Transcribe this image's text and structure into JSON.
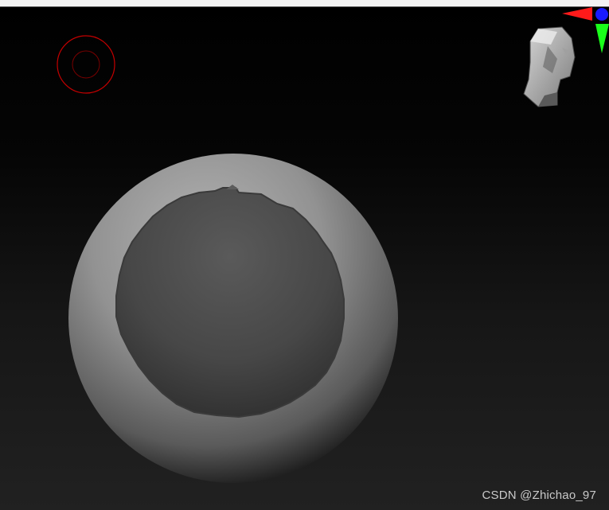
{
  "watermark": {
    "text": "CSDN @Zhichao_97"
  },
  "gizmo": {
    "axis_colors": {
      "x": "#ff1a1a",
      "y": "#1aff1a",
      "z": "#1a1aff"
    },
    "orientation_icon": "head-icon"
  },
  "brush_cursor": {
    "color": "#c40000",
    "icon": "brush-cursor-icon"
  },
  "mesh": {
    "shape": "sphere",
    "masked_region": true,
    "material_color": "#8c8c8c"
  }
}
